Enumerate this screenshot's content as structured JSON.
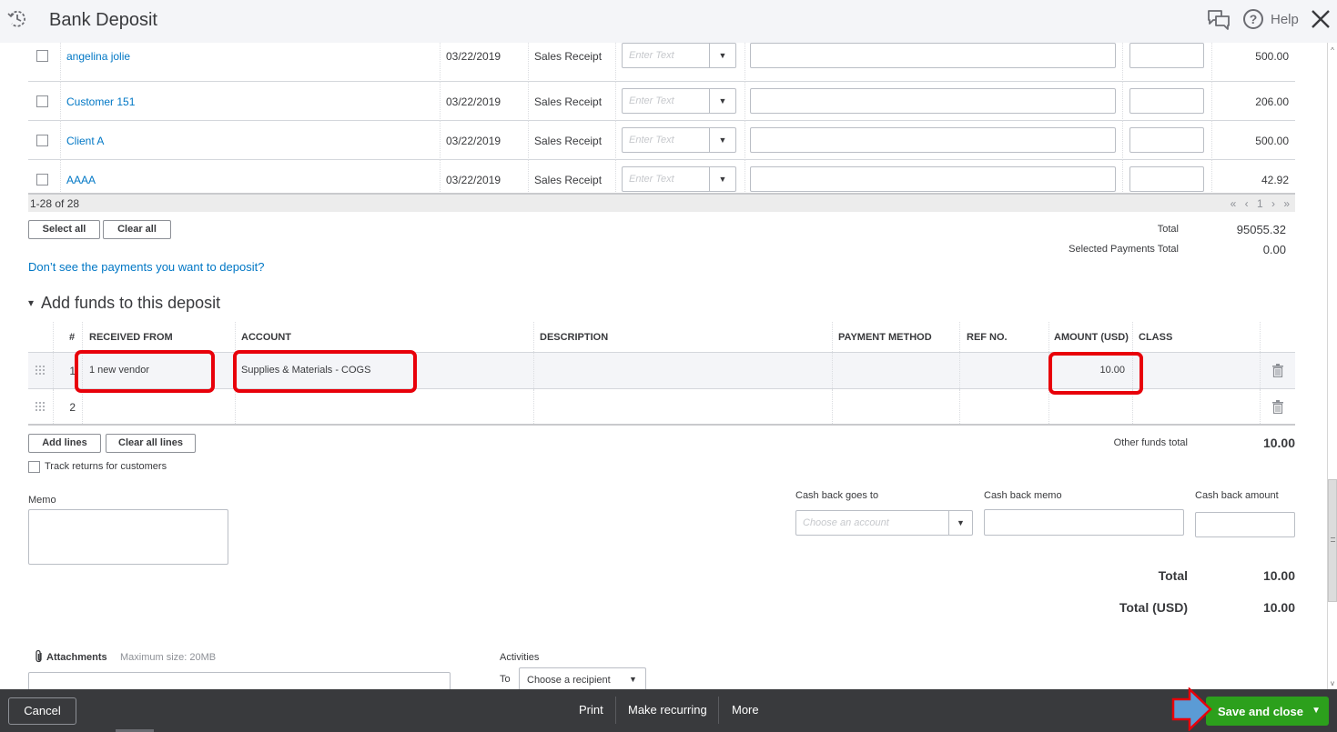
{
  "header": {
    "title": "Bank Deposit",
    "help_label": "Help",
    "help_glyph": "?"
  },
  "payments": {
    "rows": [
      {
        "name": "angelina jolie",
        "date": "03/22/2019",
        "type": "Sales Receipt",
        "method_placeholder": "Enter Text",
        "memo": "",
        "ref": "",
        "amount": "500.00",
        "checked": false
      },
      {
        "name": "Customer 151",
        "date": "03/22/2019",
        "type": "Sales Receipt",
        "method_placeholder": "Enter Text",
        "memo": "",
        "ref": "",
        "amount": "206.00",
        "checked": false
      },
      {
        "name": "Client A",
        "date": "03/22/2019",
        "type": "Sales Receipt",
        "method_placeholder": "Enter Text",
        "memo": "",
        "ref": "",
        "amount": "500.00",
        "checked": false
      },
      {
        "name": "AAAA",
        "date": "03/22/2019",
        "type": "Sales Receipt",
        "method_placeholder": "Enter Text",
        "memo": "",
        "ref": "",
        "amount": "42.92",
        "checked": false
      }
    ],
    "pager_count": "1-28 of 28",
    "pager_nav": "« ‹ 1 › »",
    "select_all_label": "Select all",
    "clear_all_label": "Clear all",
    "total_label": "Total",
    "total_value": "95055.32",
    "selected_total_label": "Selected Payments Total",
    "selected_total_value": "0.00",
    "missing_link": "Don’t see the payments you want to deposit?"
  },
  "funds": {
    "section_title": "Add funds to this deposit",
    "section_toggle": "▾",
    "columns": {
      "num": "#",
      "received_from": "RECEIVED FROM",
      "account": "ACCOUNT",
      "description": "DESCRIPTION",
      "payment_method": "PAYMENT METHOD",
      "ref_no": "REF NO.",
      "amount": "AMOUNT (USD)",
      "class": "CLASS"
    },
    "rows": [
      {
        "num": "1",
        "received_from": "1 new vendor",
        "account": "Supplies & Materials - COGS",
        "description": "",
        "payment_method": "",
        "ref_no": "",
        "amount": "10.00",
        "class": ""
      },
      {
        "num": "2",
        "received_from": "",
        "account": "",
        "description": "",
        "payment_method": "",
        "ref_no": "",
        "amount": "",
        "class": ""
      }
    ],
    "add_lines_label": "Add lines",
    "clear_lines_label": "Clear all lines",
    "other_total_label": "Other funds total",
    "other_total_value": "10.00",
    "track_returns_label": "Track returns for customers"
  },
  "memo": {
    "label": "Memo",
    "value": ""
  },
  "cashback": {
    "goes_to_label": "Cash back goes to",
    "goes_to_placeholder": "Choose an account",
    "memo_label": "Cash back memo",
    "amount_label": "Cash back amount"
  },
  "totals": {
    "total_label": "Total",
    "total_value": "10.00",
    "total_usd_label": "Total (USD)",
    "total_usd_value": "10.00"
  },
  "attachments": {
    "label": "Attachments",
    "max_size": "Maximum size: 20MB"
  },
  "activities": {
    "label": "Activities",
    "to_label": "To",
    "recipient_value": "Choose a recipient"
  },
  "footer": {
    "cancel_label": "Cancel",
    "print_label": "Print",
    "recurring_label": "Make recurring",
    "more_label": "More",
    "save_label": "Save and close"
  },
  "colors": {
    "brand_green": "#2ca01c",
    "link_blue": "#0077c5",
    "annotation_red": "#e8000a",
    "annotation_arrow": "#5b9bd5",
    "footer_bg": "#393a3d"
  }
}
